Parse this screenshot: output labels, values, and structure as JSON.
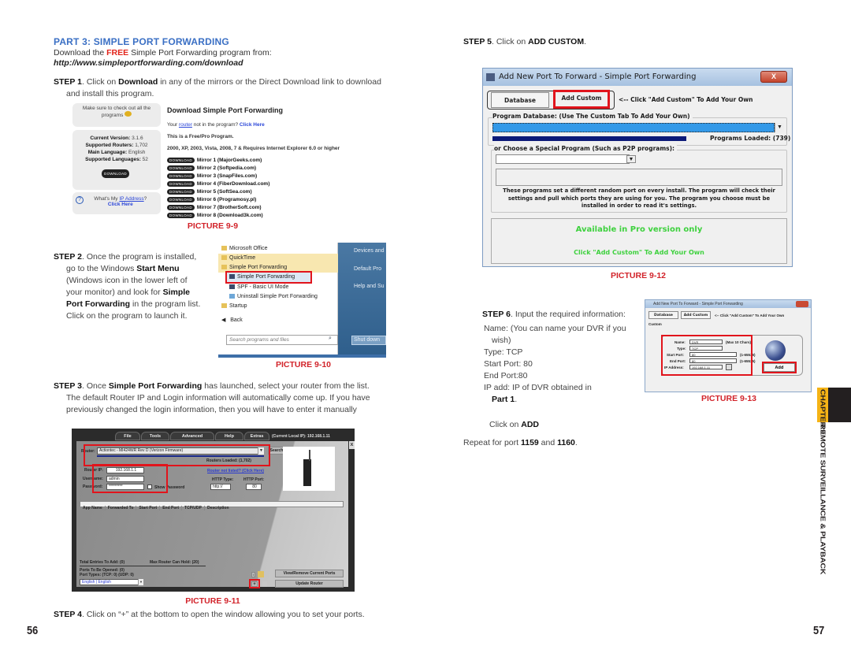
{
  "left_page": {
    "part_title": "PART 3: SIMPLE PORT FORWARDING",
    "download_line": {
      "before": "Download the ",
      "free": "FREE",
      "after": " Simple Port Forwarding program from:"
    },
    "url": "http://www.simpleportforwarding.com/download",
    "step1": {
      "label": "STEP 1",
      "text1": ". Click on ",
      "bold": "Download",
      "text2": " in any of the mirrors or the Direct Download link to download",
      "line2": "and install this program."
    },
    "picture_9_9": {
      "caption": "PICTURE 9-9",
      "promo": {
        "line1": "Make sure to check out all the",
        "line2": "programs"
      },
      "info": [
        {
          "label": "Current Version:",
          "value": "3.1.6"
        },
        {
          "label": "Supported Routers:",
          "value": "1,702"
        },
        {
          "label": "Main Language:",
          "value": "English"
        },
        {
          "label": "Supported Languages:",
          "value": "52"
        }
      ],
      "download_pill": "DOWNLOAD",
      "ip_box": {
        "text": "What's My ",
        "link": "IP Address",
        "suffix": "?",
        "click": "Click Here"
      },
      "heading": "Download Simple Port Forwarding",
      "router_line": {
        "before": "Your ",
        "link": "router",
        "after": " not in the program? ",
        "click": "Click Here"
      },
      "free_pro": "This is a Free/Pro Program.",
      "requirements": "2000, XP, 2003, Vista, 2008, 7 & Requires Internet Explorer 6.0 or higher",
      "mirrors": [
        "Mirror 1 (MajorGeeks.com)",
        "Mirror 2 (Softpedia.com)",
        "Mirror 3 (SnapFiles.com)",
        "Mirror 4 (FiberDownload.com)",
        "Mirror 5 (SoftSea.com)",
        "Mirror 6 (Programosy.pl)",
        "Mirror 7 (BrotherSoft.com)",
        "Mirror 8 (Download3k.com)"
      ]
    },
    "step2": {
      "label": "STEP 2",
      "lines": [
        {
          "pre": ". Once the program is installed,",
          "bold": "",
          "post": ""
        },
        {
          "pre": "go to the Windows ",
          "bold": "Start Menu",
          "post": ""
        },
        {
          "pre": "(Windows icon in the lower left of",
          "bold": "",
          "post": ""
        },
        {
          "pre": "your monitor)  and look for ",
          "bold": "Simple",
          "post": ""
        },
        {
          "pre": "",
          "bold": "Port Forwarding",
          "post": " in the program list."
        },
        {
          "pre": "Click on the program to launch it.",
          "bold": "",
          "post": ""
        }
      ]
    },
    "picture_9_10": {
      "caption": "PICTURE 9-10",
      "menu_items": [
        "Microsoft Office",
        "QuickTime",
        "Simple Port Forwarding",
        "Simple Port Forwarding",
        "SPF - Basic UI Mode",
        "Uninstall Simple Port Forwarding",
        "Startup"
      ],
      "back": "Back",
      "search_placeholder": "Search programs and files",
      "right_items": [
        "Devices and",
        "Default Pro",
        "Help and Su"
      ],
      "shutdown": "Shut down"
    },
    "step3": {
      "label": "STEP 3",
      "text1": ". Once ",
      "bold": "Simple Port Forwarding",
      "text2": " has launched, select your router from the list.",
      "line2": "The default  Router IP and Login information will automatically come up. If you have",
      "line3": "previously changed the login information, then you will have to enter it manually"
    },
    "picture_9_11": {
      "caption": "PICTURE 9-11",
      "menu": [
        "File",
        "Tools",
        "Advanced",
        "Help",
        "Extras"
      ],
      "current_ip": "(Current Local IP): 192.168.1.11",
      "router_label": "Router:",
      "router_value": "Actiontec - MI424WR Rev D (Verizon Firmware)",
      "search": "Search",
      "routers_loaded": "Routers Loaded: (1,702)",
      "router_ip_label": "Router IP:",
      "router_ip": "192.168.1.1",
      "username_label": "Username:",
      "username": "admin",
      "password_label": "Password:",
      "password": "*********",
      "show_password": "Show Password",
      "router_not_listed": "Router not listed? (Click Here)",
      "http_type_label": "HTTP Type:",
      "http_type": "http://",
      "http_port_label": "HTTP Port:",
      "http_port": "80",
      "columns": [
        "App Name",
        "Forwarded To",
        "Start Port",
        "End Port",
        "TCP/UDP",
        "Description"
      ],
      "total_entries": "Total Entries To Add: (0)",
      "max_router": "Max Router Can Hold: (20)",
      "ports_opened": "Ports To Be Opened: (0)",
      "port_types": "Port Types: (TCP: 0) (UDP: 0)",
      "language": "English | English",
      "view_remove": "View/Remove Current Ports",
      "update_router": "Update Router",
      "plus": "+"
    },
    "step4": {
      "label": "STEP 4",
      "text": ". Click on “+” at the bottom to open the window allowing you to set your ports."
    },
    "page_number": "56"
  },
  "right_page": {
    "step5": {
      "label": "STEP 5",
      "text": ". Click on ",
      "bold": "ADD CUSTOM",
      "end": "."
    },
    "picture_9_12": {
      "caption": "PICTURE 9-12",
      "window_title": "Add New Port To Forward - Simple Port Forwarding",
      "close": "X",
      "tab_database": "Database",
      "tab_add_custom": "Add Custom",
      "hint": "<-- Click \"Add Custom\" To Add Your Own",
      "program_db_label": "Program Database: (Use The Custom Tab To Add Your Own)",
      "programs_loaded": "Programs Loaded: (739)",
      "special_label": "or Choose a Special Program (Such as P2P programs):",
      "special_note": "These programs set a different random port on every install. The program will check their settings and pull which ports they are using for you. The program you choose must be installed in order to read it's settings.",
      "note_lines": [
        "These programs set a different random port on every install. The program will check their",
        "settings and pull which ports they are using for you. The program you choose must be",
        "installed in order to read it's settings."
      ],
      "pro_only": "Available in Pro version only",
      "add_custom_hint": "Click \"Add Custom\" To Add Your Own",
      "pro_color": "#3ed13e"
    },
    "step6": {
      "label": "STEP 6",
      "intro": ". Input the required information:",
      "name_line1": "Name: (You can name your DVR if you",
      "name_line2": "wish)",
      "type": "Type: TCP",
      "start_port": "Start Port: 80",
      "end_port": "End Port:80",
      "ip_line": "IP add: IP of DVR obtained in",
      "part_ref": "Part 1",
      "part_end": "."
    },
    "picture_9_13": {
      "caption": "PICTURE 9-13",
      "window_title": "Add New Port To Forward - Simple Port Forwarding",
      "tab_database": "Database",
      "tab_add_custom": "Add Custom",
      "hint": "<-- Click \"Add Custom\" To Add Your Own",
      "group": "Custom",
      "fields": [
        {
          "label": "Name:",
          "value": "DVR",
          "note": "(Max 10 Chars)"
        },
        {
          "label": "Type:",
          "value": "TCP",
          "note": ""
        },
        {
          "label": "Start Port:",
          "value": "80",
          "note": "(1-65535)"
        },
        {
          "label": "End Port:",
          "value": "80",
          "note": "(1-65535)"
        },
        {
          "label": "IP Address:",
          "value": "192.168.1.11",
          "note": ""
        }
      ],
      "add_button": "Add"
    },
    "click_add": {
      "text": "Click on ",
      "bold": "ADD"
    },
    "repeat": {
      "text": "Repeat for port ",
      "port1": "1159",
      "and": " and ",
      "port2": "1160",
      "end": "."
    },
    "page_number": "57"
  },
  "chapter_tab": {
    "chapter": "CHAPTER 9",
    "title": "REMOTE SURVEILLANCE & PLAYBACK",
    "accent": "#f5b316"
  }
}
